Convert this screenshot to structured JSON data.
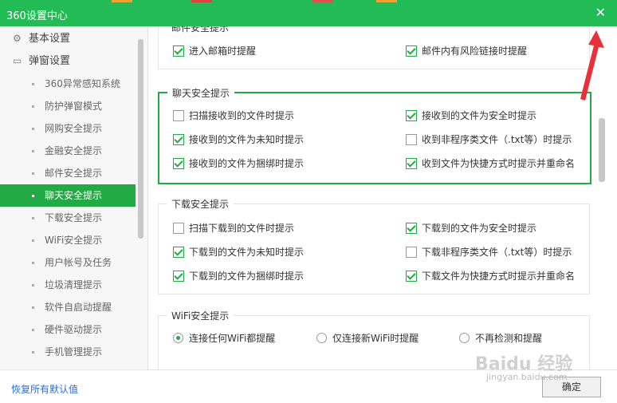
{
  "window": {
    "title": "360设置中心"
  },
  "colors": {
    "accent": "#22aa44",
    "titlebar": "#22bb55",
    "link": "#2a6fd6"
  },
  "sidebar": {
    "basic": "基本设置",
    "popup": "弹窗设置",
    "items": [
      "360异常感知系统",
      "防护弹窗模式",
      "网购安全提示",
      "金融安全提示",
      "邮件安全提示",
      "聊天安全提示",
      "下载安全提示",
      "WiFi安全提示",
      "用户帐号及任务",
      "垃圾清理提示",
      "软件自启动提醒",
      "硬件驱动提示",
      "手机管理提示"
    ],
    "active_index": 5
  },
  "mail": {
    "title": "邮件安全提示",
    "opts": [
      {
        "label": "进入邮箱时提醒",
        "checked": true
      },
      {
        "label": "邮件内有风险链接时提醒",
        "checked": true
      }
    ]
  },
  "chat": {
    "title": "聊天安全提示",
    "opts": [
      {
        "label": "扫描接收到的文件时提示",
        "checked": false
      },
      {
        "label": "接收到的文件为安全时提示",
        "checked": true
      },
      {
        "label": "接收到的文件为未知时提示",
        "checked": true
      },
      {
        "label": "收到非程序类文件（.txt等）时提示",
        "checked": false
      },
      {
        "label": "接收到的文件为捆绑时提示",
        "checked": true
      },
      {
        "label": "收到文件为快捷方式时提示并重命名",
        "checked": true
      }
    ]
  },
  "download": {
    "title": "下载安全提示",
    "opts": [
      {
        "label": "扫描下载到的文件时提示",
        "checked": false
      },
      {
        "label": "下载到的文件为安全时提示",
        "checked": true
      },
      {
        "label": "下载到的文件为未知时提示",
        "checked": true
      },
      {
        "label": "下载非程序类文件（.txt等）时提示",
        "checked": false
      },
      {
        "label": "下载到的文件为捆绑时提示",
        "checked": true
      },
      {
        "label": "下载文件为快捷方式时提示并重命名",
        "checked": true
      }
    ]
  },
  "wifi": {
    "title": "WiFi安全提示",
    "opts": [
      {
        "label": "连接任何WiFi都提醒",
        "selected": true
      },
      {
        "label": "仅连接新WiFi时提醒",
        "selected": false
      },
      {
        "label": "不再检测和提醒",
        "selected": false
      }
    ]
  },
  "footer": {
    "restore": "恢复所有默认值",
    "ok": "确定"
  },
  "watermark": {
    "text": "Baidu 经验",
    "sub": "jingyan.baidu.com"
  }
}
